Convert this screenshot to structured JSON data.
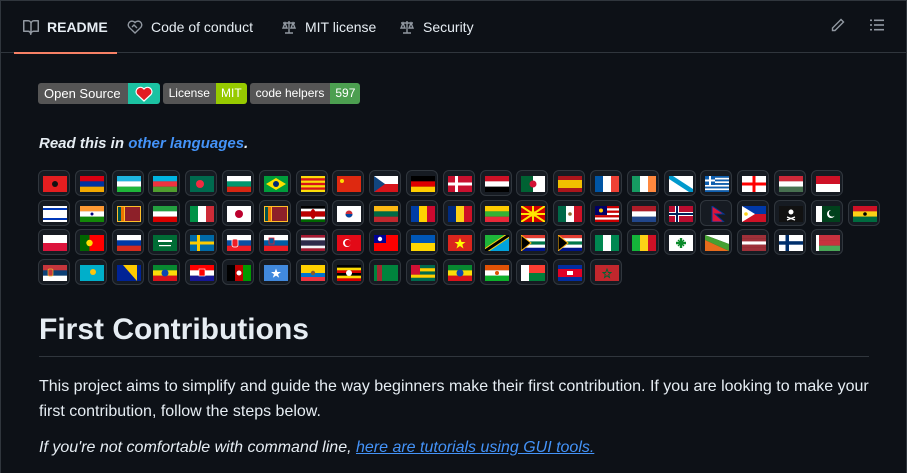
{
  "tabs": [
    {
      "label": "README",
      "icon": "book-icon",
      "active": true
    },
    {
      "label": "Code of conduct",
      "icon": "heart-handshake-icon",
      "active": false
    },
    {
      "label": "MIT license",
      "icon": "law-scale-icon",
      "active": false
    },
    {
      "label": "Security",
      "icon": "law-scale-icon",
      "active": false
    }
  ],
  "toolbar": {
    "edit_icon": "pencil-icon",
    "outline_icon": "list-icon"
  },
  "badges": {
    "open_source": {
      "left": "Open Source",
      "right_icon": "heart-icon",
      "right_color": "#1bc2a2"
    },
    "license": {
      "left": "License",
      "right": "MIT",
      "right_color": "#97ca00"
    },
    "helpers": {
      "left": "code helpers",
      "right": "597",
      "right_color": "#4c9f50"
    }
  },
  "read_in": {
    "prefix": "Read this in ",
    "link": "other languages",
    "suffix": "."
  },
  "flags": [
    [
      "Albania",
      "Armenia",
      "Uzbekistan",
      "Azerbaijan",
      "Bangladesh",
      "Bulgaria",
      "Brazil",
      "Catalonia",
      "China",
      "Czech Republic",
      "Germany",
      "Denmark",
      "Egypt",
      "Algeria",
      "Spain",
      "France",
      "Ireland",
      "Galicia",
      "Greece",
      "Georgia",
      "Hungary",
      "Indonesia"
    ],
    [
      "Israel",
      "India",
      "Sri Lanka",
      "Iran",
      "Italy",
      "Japan",
      "Sri Lanka",
      "Kenya",
      "South Korea",
      "Lithuania",
      "Moldova",
      "Romania",
      "Myanmar",
      "North Macedonia",
      "Mexico",
      "Malaysia",
      "Netherlands",
      "Norway",
      "Nepal",
      "Philippines",
      "Pirate",
      "Pakistan",
      "Ghana"
    ],
    [
      "Poland",
      "Portugal",
      "Russia",
      "Saudi Arabia",
      "Sweden",
      "Slovakia",
      "Slovenia",
      "Thailand",
      "Turkey",
      "Taiwan",
      "Ukraine",
      "Vietnam",
      "Tanzania",
      "South Africa",
      "South Africa",
      "Nigeria",
      "Mali",
      "Kabylia",
      "Wakanda",
      "Latvia",
      "Finland",
      "Belarus"
    ],
    [
      "Serbia",
      "Kazakhstan",
      "Bosnia",
      "Ethiopia",
      "Croatia",
      "Afghanistan",
      "Somalia",
      "Ecuador",
      "Uganda",
      "Turkmenistan",
      "Togo",
      "Ethiopia",
      "Niger",
      "Madagascar",
      "Cambodia",
      "Morocco"
    ]
  ],
  "heading": "First Contributions",
  "paragraph": "This project aims to simplify and guide the way beginners make their first contribution. If you are looking to make your first contribution, follow the steps below.",
  "gui_line": {
    "prefix": "If you're not comfortable with command line, ",
    "link": "here are tutorials using GUI tools."
  },
  "colors": {
    "accent": "#f78166",
    "link": "#4493f8",
    "background": "#0d1117",
    "border": "#30363d"
  }
}
